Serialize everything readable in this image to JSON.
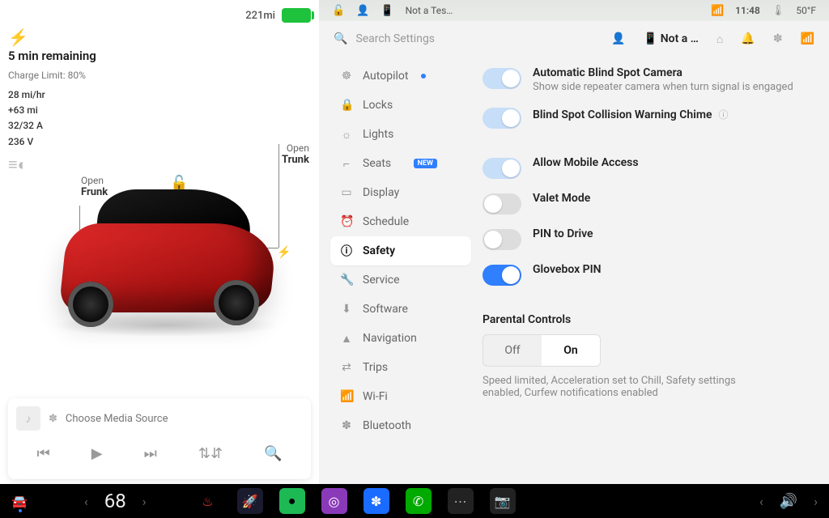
{
  "left": {
    "range": "221mi",
    "remaining": "5 min remaining",
    "charge_limit": "Charge Limit: 80%",
    "stats": {
      "rate": "28 mi/hr",
      "added": "+63 mi",
      "amps": "32/32 A",
      "volts": "236 V"
    },
    "open_label": "Open",
    "frunk_label": "Frunk",
    "trunk_label": "Trunk",
    "media_source": "Choose Media Source"
  },
  "status": {
    "profile": "Not a Tes…",
    "time": "11:48",
    "temp": "50°F"
  },
  "header": {
    "search_placeholder": "Search Settings",
    "user_short": "Not a …"
  },
  "sidebar": {
    "items": [
      {
        "icon": "⊘",
        "label": "Autopilot",
        "dot": true
      },
      {
        "icon": "🔒",
        "label": "Locks"
      },
      {
        "icon": "☀",
        "label": "Lights"
      },
      {
        "icon": "⎺⎺",
        "label": "Seats",
        "badge": "NEW"
      },
      {
        "icon": "▭",
        "label": "Display"
      },
      {
        "icon": "⏱",
        "label": "Schedule"
      },
      {
        "icon": "ⓘ",
        "label": "Safety",
        "active": true
      },
      {
        "icon": "🔧",
        "label": "Service"
      },
      {
        "icon": "⬇",
        "label": "Software"
      },
      {
        "icon": "▲",
        "label": "Navigation"
      },
      {
        "icon": "⇄",
        "label": "Trips"
      },
      {
        "icon": "📶",
        "label": "Wi-Fi"
      },
      {
        "icon": "✽",
        "label": "Bluetooth"
      }
    ]
  },
  "settings": {
    "blind_spot_cam": {
      "label": "Automatic Blind Spot Camera",
      "sub": "Show side repeater camera when turn signal is engaged",
      "state": "on-soft"
    },
    "blind_spot_chime": {
      "label": "Blind Spot Collision Warning Chime",
      "state": "on-soft",
      "info": true
    },
    "mobile_access": {
      "label": "Allow Mobile Access",
      "state": "on-soft"
    },
    "valet": {
      "label": "Valet Mode",
      "state": "off"
    },
    "pin_drive": {
      "label": "PIN to Drive",
      "state": "off"
    },
    "glovebox": {
      "label": "Glovebox PIN",
      "state": "on-strong"
    },
    "parental": {
      "title": "Parental Controls",
      "off": "Off",
      "on": "On",
      "desc": "Speed limited, Acceleration set to Chill, Safety settings enabled, Curfew notifications enabled"
    }
  },
  "dock": {
    "temp": "68"
  }
}
